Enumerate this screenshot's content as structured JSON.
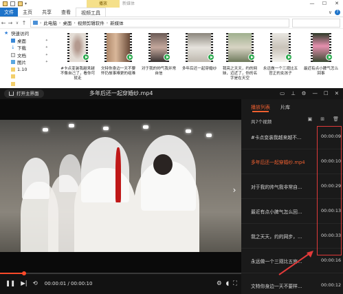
{
  "explorer": {
    "ribbon_context_tab": "播放",
    "ribbon_context_title": "新媒体",
    "tabs": [
      "文件",
      "主页",
      "共享",
      "查看",
      "视频工具"
    ],
    "breadcrumb": [
      "此电脑",
      "桌面",
      "视频剪辑软件",
      "新媒体"
    ],
    "nav_items": [
      {
        "label": "快速访问",
        "icon": "star-icon"
      },
      {
        "label": "桌面",
        "icon": "desktop-icon",
        "pinned": true
      },
      {
        "label": "下载",
        "icon": "download-icon",
        "pinned": true
      },
      {
        "label": "文档",
        "icon": "document-icon",
        "pinned": true
      },
      {
        "label": "图片",
        "icon": "picture-icon",
        "pinned": true
      },
      {
        "label": "1.10",
        "icon": "folder-icon"
      },
      {
        "label": "",
        "icon": "folder-icon"
      },
      {
        "label": "",
        "icon": "folder-icon"
      }
    ],
    "files": [
      "#卡点变装我越来越不像自己了，看你可就走",
      "文特你身边一天不要怀仍故事难更的组难",
      "对于我的帅气我并常自信",
      "多年后还一起穿婚纱",
      "我亮之天天，约的网妹，迈近了，你的名字是在天空",
      "永远做一个三观比五官正的女孩子",
      "最近有点小脾气怎么回事"
    ]
  },
  "player": {
    "open_main_label": "打开主界面",
    "video_title": "多年后还一起穿婚纱.mp4",
    "tabs": {
      "playlist": "播放列表",
      "library": "片库"
    },
    "count_label": "共7个视频",
    "items": [
      {
        "name": "#卡点变装我越来越不...",
        "duration": "00:00:09",
        "playing": false
      },
      {
        "name": "多年后还一起穿婚纱.mp4",
        "duration": "00:00:10",
        "playing": true
      },
      {
        "name": "对于我的帅气我非常自...",
        "duration": "00:00:29",
        "playing": false
      },
      {
        "name": "最近有点小脾气怎么回...",
        "duration": "00:00:13",
        "playing": false
      },
      {
        "name": "我之天天，约的网步，...",
        "duration": "00:00:33",
        "playing": false
      },
      {
        "name": "永远做一个三观比五官...",
        "duration": "00:00:16",
        "playing": false
      },
      {
        "name": "文特你身边一天不要样...",
        "duration": "00:00:12",
        "playing": false
      }
    ],
    "time_display": "00:00:01 / 00:00:10",
    "progress": 0.1,
    "accent_color": "#f06030",
    "annotation_color": "#e23a3a"
  }
}
